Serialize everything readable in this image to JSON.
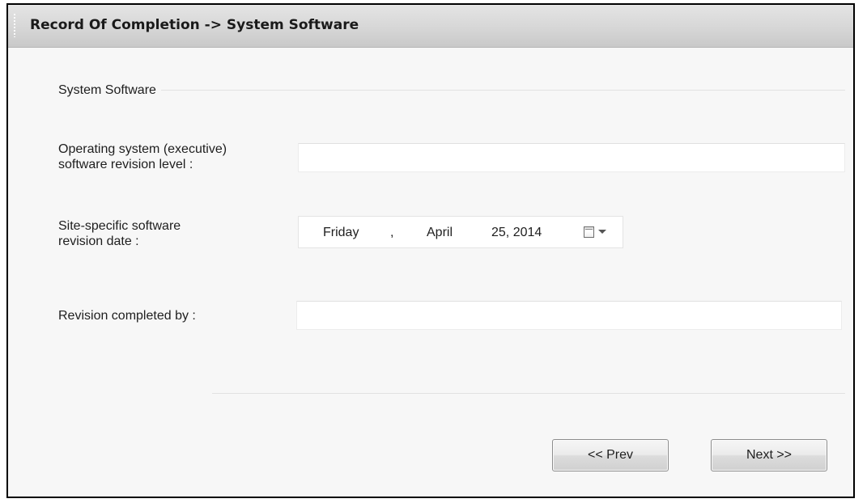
{
  "header": {
    "title": "Record Of Completion -> System Software"
  },
  "section": {
    "label": "System Software"
  },
  "fields": {
    "os_revision": {
      "label_line1": "Operating system (executive)",
      "label_line2": "software revision level :",
      "value": ""
    },
    "site_revision_date": {
      "label_line1": "Site-specific software",
      "label_line2": "revision date :",
      "weekday": "Friday",
      "separator": ",",
      "month": "April",
      "day_year": "25, 2014",
      "calendar_icon": "calendar-icon",
      "dropdown_icon": "chevron-down-icon"
    },
    "completed_by": {
      "label": "Revision completed by :",
      "value": ""
    }
  },
  "buttons": {
    "prev_label": "<< Prev",
    "next_label": "Next >>"
  },
  "colors": {
    "frame_border": "#000000",
    "panel_background": "#f7f7f7",
    "title_bar": "#d8d8d8"
  }
}
